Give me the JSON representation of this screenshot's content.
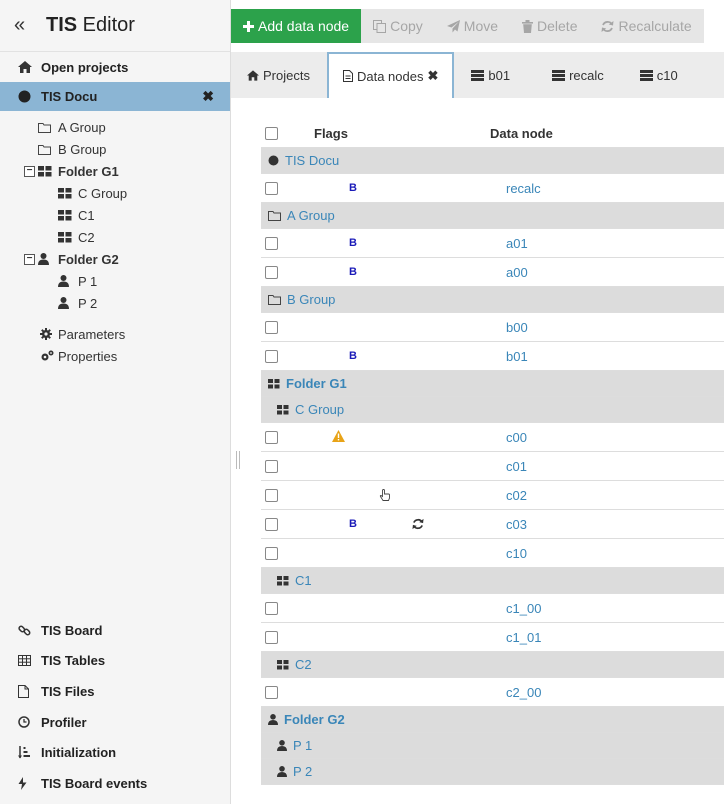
{
  "sidebar": {
    "title_bold": "TIS",
    "title_rest": " Editor",
    "open_projects": "Open projects",
    "active_project": "TIS Docu",
    "tree": {
      "a_group": "A Group",
      "b_group": "B Group",
      "folder_g1": "Folder G1",
      "c_group": "C Group",
      "c1": "C1",
      "c2": "C2",
      "folder_g2": "Folder G2",
      "p1": "P 1",
      "p2": "P 2",
      "parameters": "Parameters",
      "properties": "Properties"
    },
    "bottom": {
      "tis_board": "TIS Board",
      "tis_tables": "TIS Tables",
      "tis_files": "TIS Files",
      "profiler": "Profiler",
      "initialization": "Initialization",
      "tis_board_events": "TIS Board events"
    }
  },
  "toolbar": {
    "add": "Add data node",
    "copy": "Copy",
    "move": "Move",
    "delete": "Delete",
    "recalculate": "Recalculate"
  },
  "tabs": {
    "projects": "Projects",
    "data_nodes": "Data nodes",
    "b01": "b01",
    "recalc": "recalc",
    "c10": "c10"
  },
  "table": {
    "col_flags": "Flags",
    "col_node": "Data node",
    "groups": {
      "tis_docu": "TIS Docu",
      "a_group": "A Group",
      "b_group": "B Group",
      "folder_g1": "Folder G1",
      "c_group": "C Group",
      "c1": "C1",
      "c2": "C2",
      "folder_g2": "Folder G2",
      "p1": "P 1",
      "p2": "P 2"
    },
    "flag_b": "B",
    "nodes": {
      "recalc": "recalc",
      "a01": "a01",
      "a00": "a00",
      "b00": "b00",
      "b01": "b01",
      "c00": "c00",
      "c01": "c01",
      "c02": "c02",
      "c03": "c03",
      "c10": "c10",
      "c1_00": "c1_00",
      "c1_01": "c1_01",
      "c2_00": "c2_00"
    }
  },
  "colors": {
    "accent": "#8bb5d4",
    "primary_button": "#2ca24b",
    "link": "#3a86b8",
    "flag_b": "#1a1ab8",
    "warning": "#e8a317"
  }
}
